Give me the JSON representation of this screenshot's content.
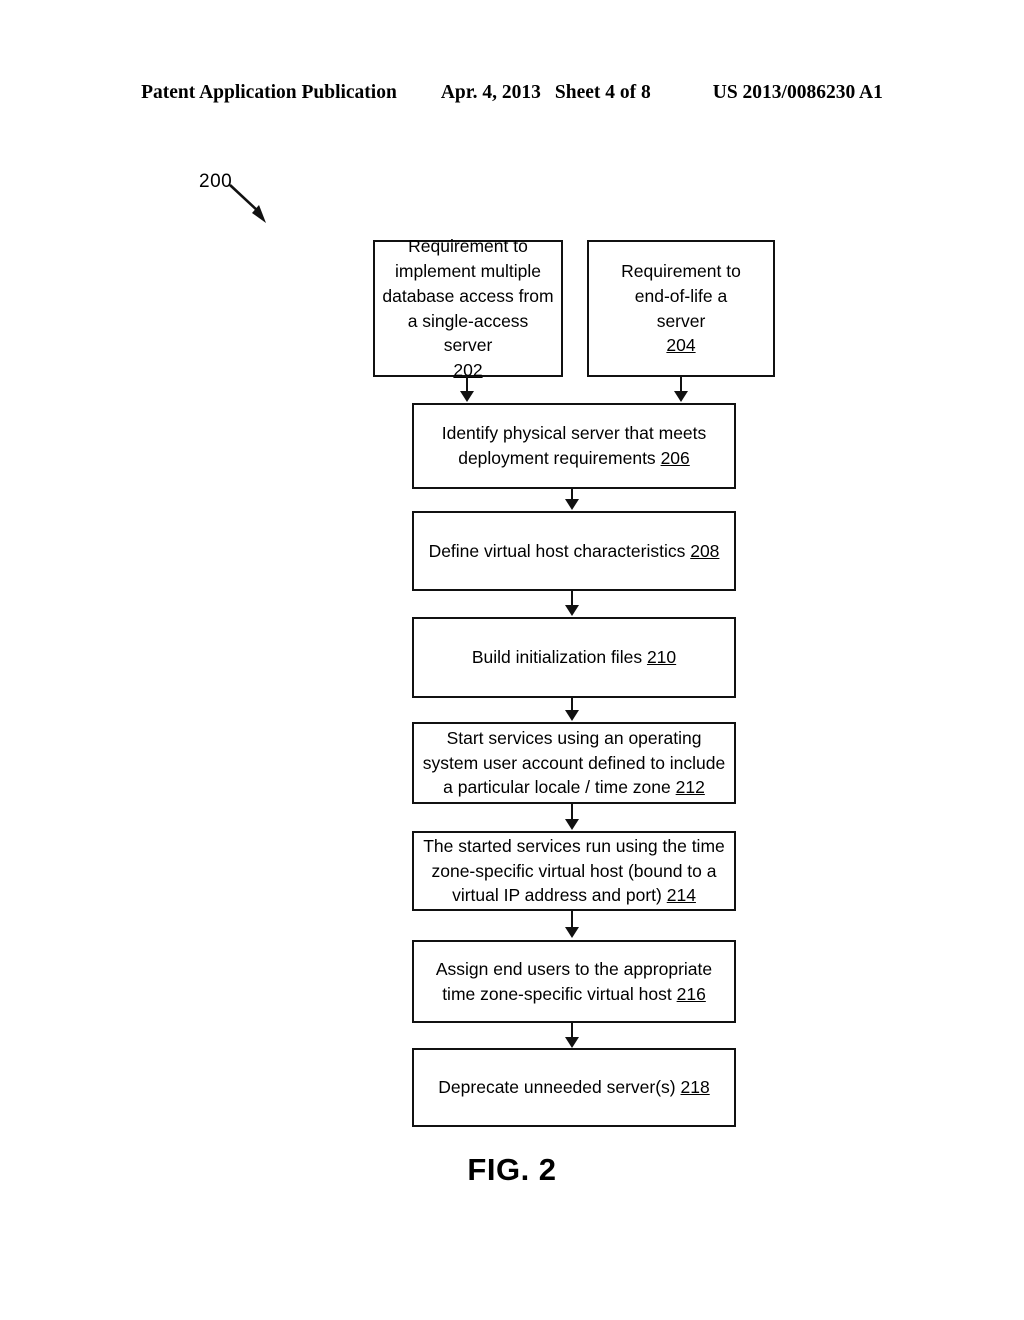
{
  "header": {
    "publication": "Patent Application Publication",
    "date": "Apr. 4, 2013",
    "sheet": "Sheet 4 of 8",
    "document_number": "US 2013/0086230 A1"
  },
  "figure": {
    "caption": "FIG. 2",
    "diagram_reference": "200",
    "colors": {
      "ink": "#111111",
      "paper": "#ffffff"
    },
    "nodes": [
      {
        "id": "202",
        "lines": [
          "Requirement to",
          "implement multiple",
          "database access from",
          "a single-access server"
        ],
        "ref": "202"
      },
      {
        "id": "204",
        "lines": [
          "Requirement to",
          "end-of-life a",
          "server"
        ],
        "ref": "204"
      },
      {
        "id": "206",
        "lines": [
          "Identify physical server that meets",
          "deployment requirements"
        ],
        "ref": "206"
      },
      {
        "id": "208",
        "lines": [
          "Define virtual host characteristics"
        ],
        "ref": "208"
      },
      {
        "id": "210",
        "lines": [
          "Build initialization files"
        ],
        "ref": "210"
      },
      {
        "id": "212",
        "lines": [
          "Start services using an operating",
          "system user account defined to include",
          "a particular locale / time zone"
        ],
        "ref": "212"
      },
      {
        "id": "214",
        "lines": [
          "The started services run using the time",
          "zone-specific virtual host (bound to a",
          "virtual IP address and port)"
        ],
        "ref": "214"
      },
      {
        "id": "216",
        "lines": [
          "Assign end users to the appropriate",
          "time zone-specific virtual host"
        ],
        "ref": "216"
      },
      {
        "id": "218",
        "lines": [
          "Deprecate unneeded server(s)"
        ],
        "ref": "218"
      }
    ],
    "edges": [
      {
        "from": "202",
        "to": "206"
      },
      {
        "from": "204",
        "to": "206"
      },
      {
        "from": "206",
        "to": "208"
      },
      {
        "from": "208",
        "to": "210"
      },
      {
        "from": "210",
        "to": "212"
      },
      {
        "from": "212",
        "to": "214"
      },
      {
        "from": "214",
        "to": "216"
      },
      {
        "from": "216",
        "to": "218"
      }
    ]
  }
}
